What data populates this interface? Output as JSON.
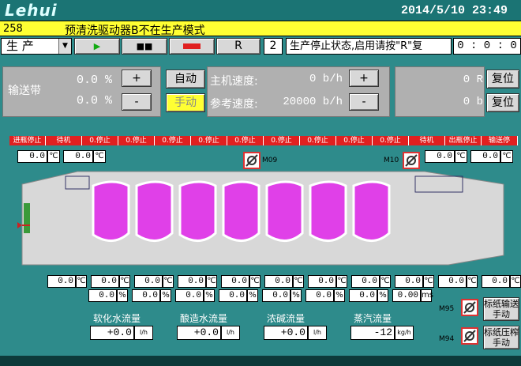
{
  "header": {
    "logo": "Lehui",
    "datetime": "2014/5/10  23:49"
  },
  "alarm": {
    "code": "258",
    "text": "预清洗驱动器B不在生产模式"
  },
  "toolbar": {
    "mode": "生 产",
    "play_icon": "play-icon",
    "pause_icon": "pause-icon",
    "stop_icon": "stop-icon",
    "reset_label": "R",
    "step": "2",
    "status": "生产停止状态,启用请按\"R\"复",
    "timer": "0 : 0 : 0"
  },
  "conveyor": {
    "label": "输送带",
    "value1": "0.0 %",
    "value2": "0.0 %",
    "plus": "+",
    "minus": "-",
    "auto": "自动",
    "manual": "手动",
    "main_speed_label": "主机速度:",
    "main_speed": "0 b/h",
    "ref_speed_label": "参考速度:",
    "ref_speed": "20000 b/h"
  },
  "counters": {
    "value1": "0 R",
    "value2": "0 b",
    "reset1": "复位",
    "reset2": "复位"
  },
  "zones": [
    "进瓶停止",
    "待机",
    "0.停止",
    "0.停止",
    "0.停止",
    "0.停止",
    "0.停止",
    "0.停止",
    "0.停止",
    "0.停止",
    "0.停止",
    "待机",
    "出瓶停止",
    "输送停"
  ],
  "temps_top": [
    "0.0",
    "0.0",
    "0.0",
    "0.0",
    "0.0"
  ],
  "motors": {
    "m09": "M09",
    "m10": "M10",
    "m95": "M95",
    "m94": "M94"
  },
  "temps_bottom": [
    "0.0",
    "0.0",
    "0.0",
    "0.0",
    "0.0",
    "0.0",
    "0.0",
    "0.0",
    "0.0",
    "0.0",
    "0.0"
  ],
  "percents": [
    "0.0",
    "0.0",
    "0.0",
    "0.0",
    "0.0",
    "0.0",
    "0.0",
    "0.00"
  ],
  "units": {
    "c": "℃",
    "pct": "%",
    "ms": "ms",
    "lh": "l/h",
    "kgh": "kg/h"
  },
  "flows": [
    {
      "label": "软化水流量",
      "value": "+0.0",
      "unit": "l/h"
    },
    {
      "label": "酿造水流量",
      "value": "+0.0",
      "unit": "l/h"
    },
    {
      "label": "浓碱流量",
      "value": "+0.0",
      "unit": "l/h"
    },
    {
      "label": "蒸汽流量",
      "value": "-12",
      "unit": "kg/h"
    }
  ],
  "side_buttons": {
    "b1": "标纸输送手动",
    "b2": "标纸压榨手动"
  },
  "colors": {
    "bg": "#2e8b8b",
    "alarm": "#ffff33",
    "tank": "#e040e8",
    "red": "#e02020"
  }
}
